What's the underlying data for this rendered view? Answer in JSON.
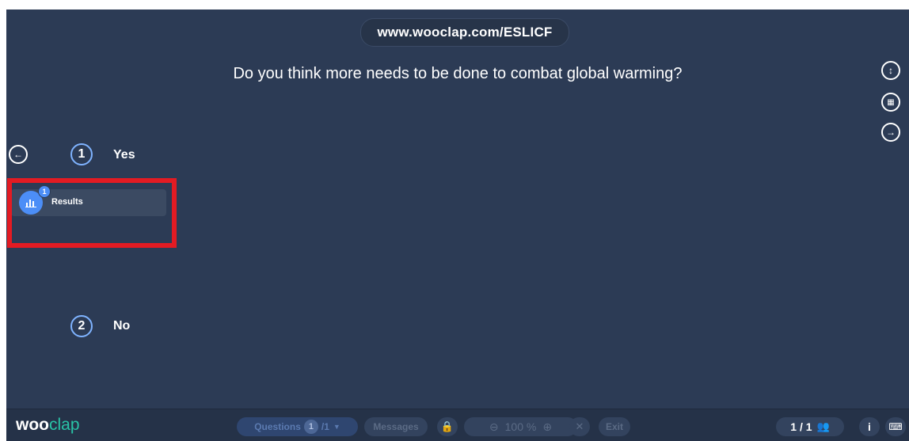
{
  "url": "www.wooclap.com/ESLICF",
  "question": "Do you think more needs to be done to combat global warming?",
  "answers": [
    {
      "number": "1",
      "label": "Yes"
    },
    {
      "number": "2",
      "label": "No"
    }
  ],
  "results_panel": {
    "label": "Results",
    "badge": "1"
  },
  "logo": {
    "part1": "woo",
    "part2": "clap"
  },
  "toolbar": {
    "questions_label": "Questions",
    "current_question": "1",
    "total_questions": "/1",
    "messages_label": "Messages",
    "zoom_value": "100 %",
    "exit_label": "Exit"
  },
  "participants": "1 / 1",
  "icons": {
    "left_arrow": "left-arrow-icon",
    "right_arrow": "right-arrow-icon",
    "fullscreen_vertical": "vertical-arrows-icon",
    "qr": "qr-code-icon",
    "chart": "bar-chart-icon",
    "lock": "lock-icon",
    "zoom_out": "zoom-out-icon",
    "zoom_in": "zoom-in-icon",
    "shrink": "shrink-icon",
    "people": "people-icon",
    "info": "info-icon",
    "keyboard": "keyboard-icon"
  },
  "colors": {
    "background": "#2c3b55",
    "accent_blue": "#4c8ef7",
    "highlight_red": "#e31b23",
    "logo_green": "#29c3a6"
  }
}
